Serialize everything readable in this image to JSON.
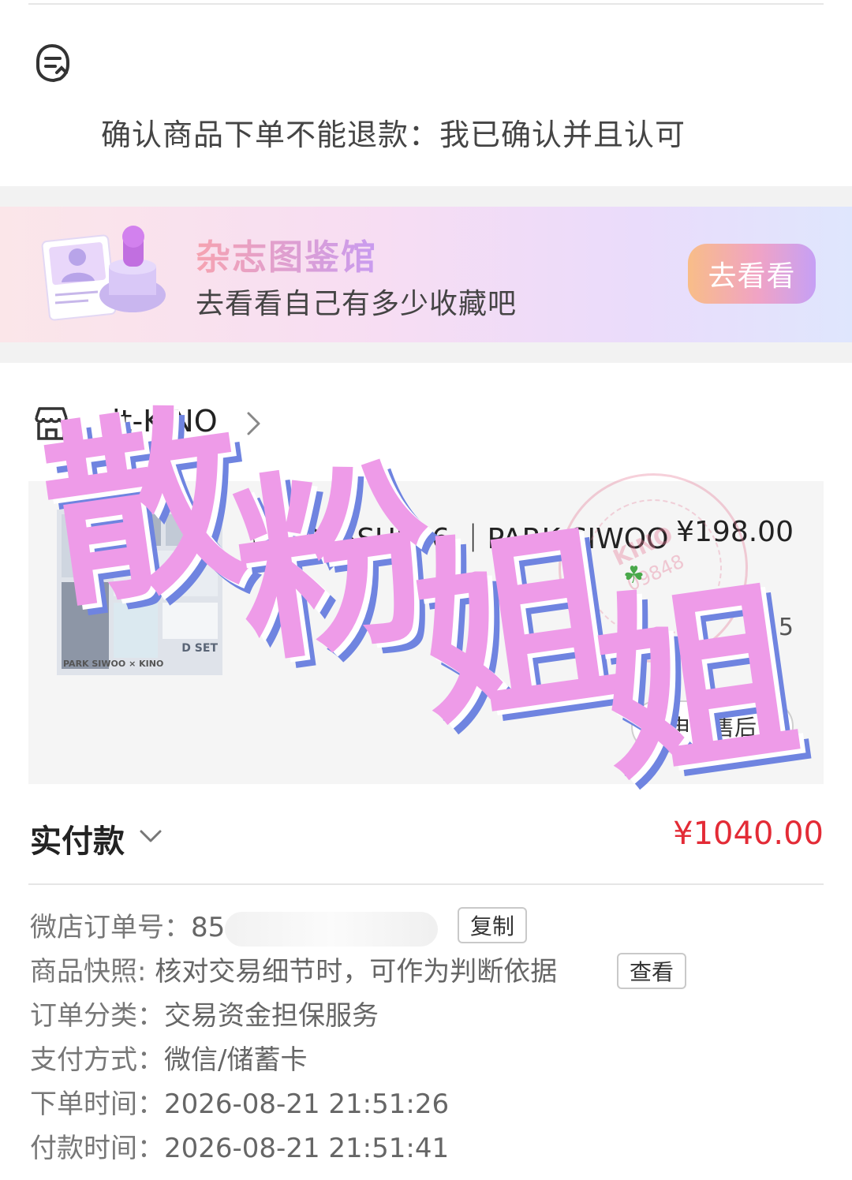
{
  "notice": {
    "text": "确认商品下单不能退款：我已确认并且认可"
  },
  "banner": {
    "title": "杂志图鉴馆",
    "subtitle": "去看看自己有多少收藏吧",
    "button_label": "去看看"
  },
  "shop": {
    "name": "it-KINO"
  },
  "product": {
    "title": "KINO ISSUE06 ｜PARK SIWOO",
    "price": "¥198.00",
    "quantity": "× 5",
    "thumb_set_label": "D SET",
    "thumb_footer": "PARK SIWOO × KINO",
    "action_label": "申请售后"
  },
  "overlay": {
    "chars": [
      "散",
      "粉",
      "姐",
      "姐"
    ],
    "color": "#ee9be8",
    "shadow_color": "#6f84e0"
  },
  "stamp": {
    "text": "KINO",
    "number": "09848"
  },
  "total": {
    "label": "实付款",
    "value": "¥1040.00",
    "color": "#e32b36"
  },
  "order_info": {
    "order_no_label": "微店订单号：",
    "order_no_value": "85",
    "copy_button": "复制",
    "snapshot_label": "商品快照: ",
    "snapshot_value": "核对交易细节时，可作为判断依据",
    "snapshot_button": "查看",
    "category_label": "订单分类：",
    "category_value": "交易资金担保服务",
    "payment_label": "支付方式：",
    "payment_value": "微信/储蓄卡",
    "order_time_label": "下单时间：",
    "order_time_value": "2026-08-21 21:51:26",
    "pay_time_label": "付款时间：",
    "pay_time_value": "2026-08-21 21:51:41"
  }
}
